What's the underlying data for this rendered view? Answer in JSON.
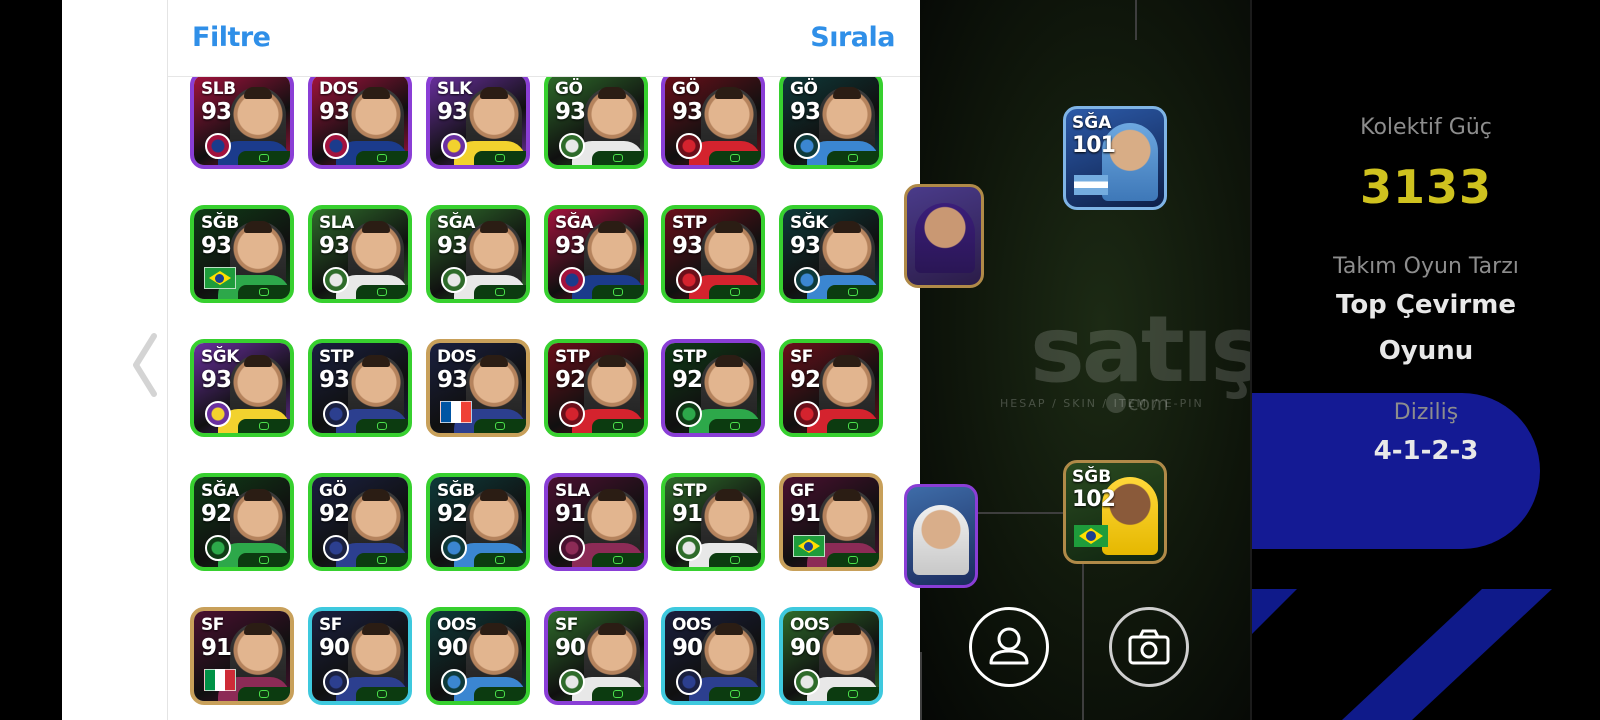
{
  "header": {
    "filter_label": "Filtre",
    "sort_label": "Sırala"
  },
  "colors": {
    "accent": "#2f8fe8",
    "collective_power": "#cfc21f",
    "formation_pill": "#141a94"
  },
  "cards": [
    {
      "pos": "SLB",
      "rating": "93",
      "rarity": "purple",
      "theme": "barca",
      "flag": "crest"
    },
    {
      "pos": "DOS",
      "rating": "93",
      "rarity": "purple",
      "theme": "barca",
      "flag": "crest"
    },
    {
      "pos": "SLK",
      "rating": "93",
      "rarity": "purple",
      "theme": "fener",
      "flag": "crest"
    },
    {
      "pos": "GÖ",
      "rating": "93",
      "rarity": "green",
      "theme": "white",
      "flag": "crest"
    },
    {
      "pos": "GÖ",
      "rating": "93",
      "rarity": "purple",
      "theme": "red",
      "flag": "crest"
    },
    {
      "pos": "GÖ",
      "rating": "93",
      "rarity": "green",
      "theme": "blue",
      "flag": "crest"
    },
    {
      "pos": "SĞB",
      "rating": "93",
      "rarity": "green",
      "theme": "green",
      "flag": "brazil"
    },
    {
      "pos": "SLA",
      "rating": "93",
      "rarity": "green",
      "theme": "white",
      "flag": "crest"
    },
    {
      "pos": "SĞA",
      "rating": "93",
      "rarity": "green",
      "theme": "white",
      "flag": "crest"
    },
    {
      "pos": "SĞA",
      "rating": "93",
      "rarity": "green",
      "theme": "barca",
      "flag": "crest"
    },
    {
      "pos": "STP",
      "rating": "93",
      "rarity": "green",
      "theme": "red",
      "flag": "crest"
    },
    {
      "pos": "SĞK",
      "rating": "93",
      "rarity": "green",
      "theme": "blue",
      "flag": "crest"
    },
    {
      "pos": "SĞK",
      "rating": "93",
      "rarity": "green",
      "theme": "fener",
      "flag": "crest"
    },
    {
      "pos": "STP",
      "rating": "93",
      "rarity": "green",
      "theme": "navy",
      "flag": "crest"
    },
    {
      "pos": "DOS",
      "rating": "93",
      "rarity": "gold",
      "theme": "navy",
      "flag": "france"
    },
    {
      "pos": "STP",
      "rating": "92",
      "rarity": "green",
      "theme": "red",
      "flag": "crest"
    },
    {
      "pos": "STP",
      "rating": "92",
      "rarity": "purple",
      "theme": "green",
      "flag": "crest"
    },
    {
      "pos": "SF",
      "rating": "92",
      "rarity": "green",
      "theme": "red",
      "flag": "crest"
    },
    {
      "pos": "SĞA",
      "rating": "92",
      "rarity": "green",
      "theme": "green",
      "flag": "crest"
    },
    {
      "pos": "GÖ",
      "rating": "92",
      "rarity": "green",
      "theme": "navy",
      "flag": "crest"
    },
    {
      "pos": "SĞB",
      "rating": "92",
      "rarity": "green",
      "theme": "blue",
      "flag": "crest"
    },
    {
      "pos": "SLA",
      "rating": "91",
      "rarity": "purple",
      "theme": "maroon",
      "flag": "crest"
    },
    {
      "pos": "STP",
      "rating": "91",
      "rarity": "green",
      "theme": "white",
      "flag": "crest"
    },
    {
      "pos": "GF",
      "rating": "91",
      "rarity": "gold",
      "theme": "maroon",
      "flag": "brazil"
    },
    {
      "pos": "SF",
      "rating": "91",
      "rarity": "gold",
      "theme": "maroon",
      "flag": "italy"
    },
    {
      "pos": "SF",
      "rating": "90",
      "rarity": "cyan",
      "theme": "navy",
      "flag": "crest"
    },
    {
      "pos": "OOS",
      "rating": "90",
      "rarity": "green",
      "theme": "blue",
      "flag": "crest"
    },
    {
      "pos": "SF",
      "rating": "90",
      "rarity": "purple",
      "theme": "white",
      "flag": "crest"
    },
    {
      "pos": "OOS",
      "rating": "90",
      "rarity": "cyan",
      "theme": "navy",
      "flag": "crest"
    },
    {
      "pos": "OOS",
      "rating": "90",
      "rarity": "cyan",
      "theme": "white",
      "flag": "crest"
    }
  ],
  "pitch": {
    "card_a": {
      "pos": "SĞA",
      "rating": "101"
    },
    "card_b": {
      "pos": "SĞB",
      "rating": "102"
    }
  },
  "watermark": {
    "main": "satış",
    "sub": "HESAP / SKIN / ITEM / E-PIN",
    "domain": "com"
  },
  "stats": {
    "collective_label": "Kolektif Güç",
    "collective_value": "3133",
    "style_label": "Takım Oyun Tarzı",
    "style_value_1": "Top Çevirme",
    "style_value_2": "Oyunu",
    "formation_label": "Diziliş",
    "formation_value": "4-1-2-3"
  },
  "icons": [
    "back-chevron-icon",
    "user-icon",
    "camera-icon"
  ]
}
